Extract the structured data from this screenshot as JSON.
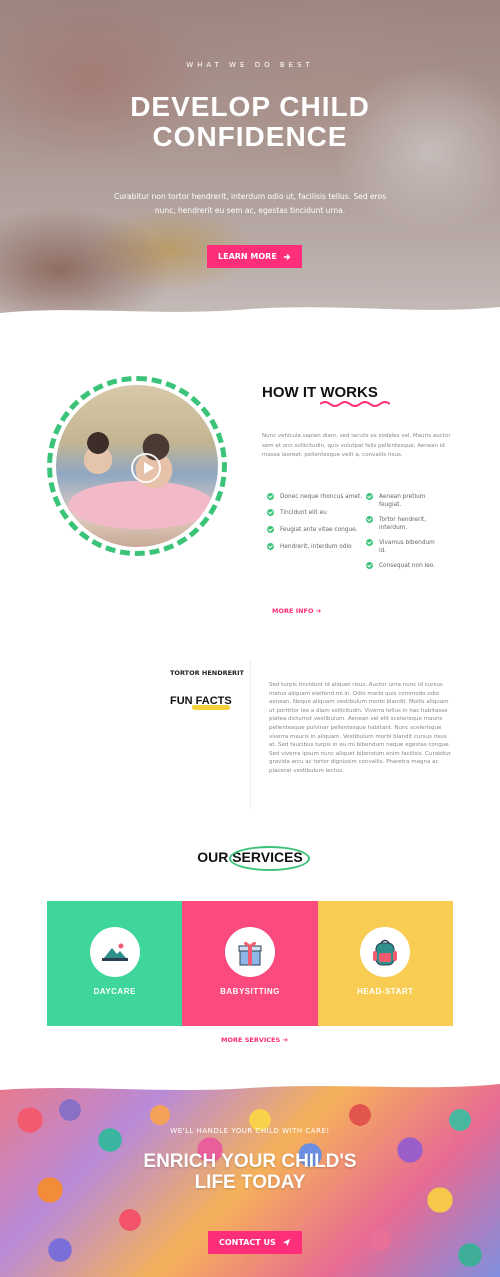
{
  "colors": {
    "pink": "#ff2e7a",
    "green": "#3cc37a",
    "service_green": "#3fd69b",
    "service_pink": "#fb4a7e",
    "service_yellow": "#f9cd53"
  },
  "hero": {
    "eyebrow": "WHAT WE DO BEST",
    "title_line1": "DEVELOP CHILD",
    "title_line2": "CONFIDENCE",
    "text": "Curabitur non tortor hendrerit, interdum odio ut, facilisis tellus. Sed eros nunc, hendrerit eu sem ac, egestas tincidunt urna.",
    "button_label": "LEARN MORE",
    "button_icon": "arrow-right-icon"
  },
  "how": {
    "title": "HOW IT WORKS",
    "text": "Nunc vehicula sapien diam, sed iaculis ex sodales vel. Mauris auctor sem et orci sollicitudin, quis volutpat felis pellentesque. Aenean id massa laoreet, pellentesque velit a, convallis risus.",
    "list_left": [
      "Donec neque rhoncus amet.",
      "Tincidunt elit eu",
      "Feugiat ante vitae congue.",
      "Hendrerit, interdum odio"
    ],
    "list_right": [
      "Aenean pretium feugiat.",
      "Tortor hendrerit, interdum.",
      "Vivamus bibendum id.",
      "Consequat non leo."
    ],
    "more_label": "MORE INFO"
  },
  "facts": {
    "label": "TORTOR HENDRERIT",
    "title": "FUN FACTS",
    "text": "Sed turpis tincidunt id aliquet risus. Auctor urna nunc id cursus metus aliquam eleifend mi in. Odio morbi quis commodo odio aenean. Neque aliquam vestibulum morbi blandit. Mollis aliquam ut porttitor leo a diam sollicitudin. Viverra tellus in hac habitasse platea dictumst vestibulum. Aenean vel elit scelerisque mauris pellentesque pulvinar pellentesque habitant. Nunc scelerisque viverra mauris in aliquam. Vestibulum morbi blandit cursus risus at. Sed faucibus turpis in eu mi bibendum neque egestas congue. Sed viverra ipsum nunc aliquet bibendum enim facilisis. Curabitur gravida arcu ac tortor dignissim convallis. Pharetra magna ac placerat vestibulum lectus."
  },
  "services": {
    "title": "OUR SERVICES",
    "items": [
      {
        "label": "DAYCARE",
        "icon": "mountain-picture-icon"
      },
      {
        "label": "BABYSITTING",
        "icon": "gift-box-icon"
      },
      {
        "label": "HEAD-START",
        "icon": "backpack-icon"
      }
    ],
    "more_label": "MORE SERVICES"
  },
  "contact": {
    "eyebrow": "WE'LL HANDLE YOUR CHILD WITH CARE!",
    "title_line1": "ENRICH YOUR CHILD'S",
    "title_line2": "LIFE TODAY",
    "button_label": "CONTACT US",
    "button_icon": "paper-plane-icon"
  }
}
